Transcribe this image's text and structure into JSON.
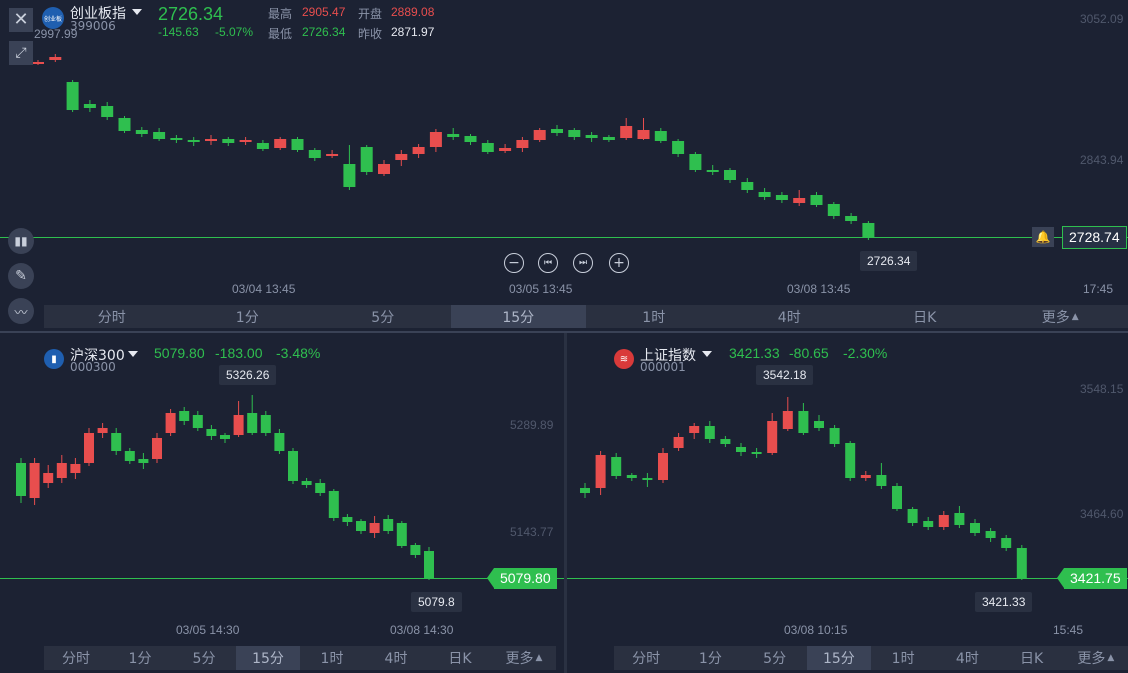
{
  "colors": {
    "up": "#e84e4e",
    "down": "#2fbf4f",
    "bg": "#1c2233",
    "panel": "#2a3040",
    "line": "#2fbf4f"
  },
  "top": {
    "name": "创业板指",
    "code": "399006",
    "logo_text": "创业板",
    "price": "2726.34",
    "change": "-145.63",
    "change_pct": "-5.07%",
    "high_label": "最高",
    "high": "2905.47",
    "open_label": "开盘",
    "open": "2889.08",
    "low_label": "最低",
    "low": "2726.34",
    "prev_label": "昨收",
    "prev": "2871.97",
    "first_high": "2997.99",
    "axis": [
      "3052.09",
      "2843.94"
    ],
    "current_tag": "2728.74",
    "last_box": "2726.34",
    "times": [
      "03/04 13:45",
      "03/05 13:45",
      "03/08 13:45",
      "17:45"
    ],
    "icons": [
      "close-icon",
      "expand-icon",
      "candle-type-icon",
      "draw-pen-icon",
      "indicator-icon",
      "bell-icon",
      "zoom-out-icon",
      "step-back-icon",
      "step-forward-icon",
      "zoom-in-icon"
    ],
    "timeframes": [
      "分时",
      "1分",
      "5分",
      "15分",
      "1时",
      "4时",
      "日K",
      "更多"
    ],
    "active_tf": "15分"
  },
  "left": {
    "name": "沪深300",
    "code": "000300",
    "price": "5079.80",
    "change": "-183.00",
    "change_pct": "-3.48%",
    "high_box": "5326.26",
    "axis": [
      "5289.89",
      "5143.77"
    ],
    "current_tag": "5079.80",
    "last_box": "5079.8",
    "times": [
      "03/05 14:30",
      "03/08 14:30"
    ],
    "timeframes": [
      "分时",
      "1分",
      "5分",
      "15分",
      "1时",
      "4时",
      "日K",
      "更多"
    ],
    "active_tf": "15分"
  },
  "right": {
    "name": "上证指数",
    "code": "000001",
    "price": "3421.33",
    "change": "-80.65",
    "change_pct": "-2.30%",
    "high_box": "3542.18",
    "axis": [
      "3548.15",
      "3464.60"
    ],
    "current_tag": "3421.75",
    "last_box": "3421.33",
    "times": [
      "03/08 10:15",
      "15:45"
    ],
    "timeframes": [
      "分时",
      "1分",
      "5分",
      "15分",
      "1时",
      "4时",
      "日K",
      "更多"
    ],
    "active_tf": "15分"
  }
}
